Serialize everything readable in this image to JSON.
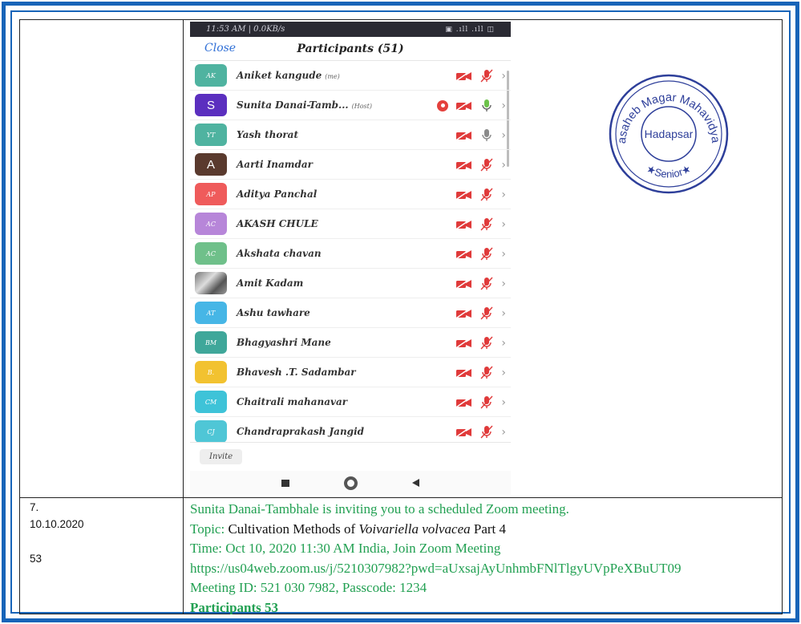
{
  "phone": {
    "status_left": "11:53 AM | 0.0KB/s",
    "status_right": "▣ .ıll .ıll ◫",
    "close_label": "Close",
    "title": "Participants (51)",
    "invite_label": "Invite",
    "participants": [
      {
        "initials": "AK",
        "name": "Aniket kangude",
        "tag": "(me)",
        "color": "#4fb3a0",
        "big": false,
        "photo": false,
        "host": false,
        "mic_on": false
      },
      {
        "initials": "S",
        "name": "Sunita Danai-Tamb...",
        "tag": "(Host)",
        "color": "#5b2fbf",
        "big": true,
        "photo": false,
        "host": true,
        "mic_on": true
      },
      {
        "initials": "YT",
        "name": "Yash thorat",
        "tag": "",
        "color": "#4fb3a0",
        "big": false,
        "photo": false,
        "host": false,
        "mic_on": true
      },
      {
        "initials": "A",
        "name": "Aarti Inamdar",
        "tag": "",
        "color": "#5a3a2e",
        "big": true,
        "photo": false,
        "host": false,
        "mic_on": false
      },
      {
        "initials": "AP",
        "name": "Aditya Panchal",
        "tag": "",
        "color": "#ef5b5b",
        "big": false,
        "photo": false,
        "host": false,
        "mic_on": false
      },
      {
        "initials": "AC",
        "name": "AKASH CHULE",
        "tag": "",
        "color": "#b786d9",
        "big": false,
        "photo": false,
        "host": false,
        "mic_on": false
      },
      {
        "initials": "AC",
        "name": "Akshata chavan",
        "tag": "",
        "color": "#6fc08a",
        "big": false,
        "photo": false,
        "host": false,
        "mic_on": false
      },
      {
        "initials": "",
        "name": "Amit Kadam",
        "tag": "",
        "color": "#888888",
        "big": false,
        "photo": true,
        "host": false,
        "mic_on": false
      },
      {
        "initials": "AT",
        "name": "Ashu tawhare",
        "tag": "",
        "color": "#46b6e6",
        "big": false,
        "photo": false,
        "host": false,
        "mic_on": false
      },
      {
        "initials": "BM",
        "name": "Bhagyashri Mane",
        "tag": "",
        "color": "#3fa79a",
        "big": false,
        "photo": false,
        "host": false,
        "mic_on": false
      },
      {
        "initials": "B.",
        "name": "Bhavesh .T. Sadambar",
        "tag": "",
        "color": "#f2c230",
        "big": false,
        "photo": false,
        "host": false,
        "mic_on": false
      },
      {
        "initials": "CM",
        "name": "Chaitrali mahanavar",
        "tag": "",
        "color": "#3ec3d8",
        "big": false,
        "photo": false,
        "host": false,
        "mic_on": false
      },
      {
        "initials": "CJ",
        "name": "Chandraprakash Jangid",
        "tag": "",
        "color": "#4fc6d6",
        "big": false,
        "photo": false,
        "host": false,
        "mic_on": false
      }
    ]
  },
  "stamp": {
    "arc_text": "Annasaheb Magar Mahavidyalaya",
    "center": "Hadapsar",
    "bottom": "★Senior★"
  },
  "entry": {
    "serial": "7.",
    "date": "10.10.2020",
    "count": "53",
    "invite_line": "Sunita Danai-Tambhale is inviting you to a scheduled Zoom meeting.",
    "topic_label": "Topic:",
    "topic_pre": "Cultivation Methods of",
    "topic_italic": "Voivariella volvacea",
    "topic_post": "Part 4",
    "time_line": "Time: Oct 10, 2020 11:30 AM India, Join Zoom Meeting",
    "url_line": "https://us04web.zoom.us/j/5210307982?pwd=aUxsajAyUnhmbFNlTlgyUVpPeXBuUT09",
    "meeting_line": "Meeting ID: 521 030 7982, Passcode: 1234",
    "participants_line": "Participants 53"
  },
  "colors": {
    "border_blue": "#1764b8",
    "text_green": "#22a052",
    "muted_red": "#e03a3a"
  }
}
